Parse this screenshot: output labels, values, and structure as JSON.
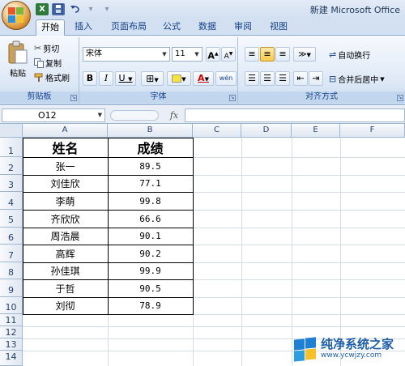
{
  "app": {
    "title": "新建 Microsoft Office",
    "colors": {
      "ribbon_blue": "#15428b",
      "accent_orange": "#d98b2b"
    }
  },
  "quick_access": [
    {
      "icon": "excel-icon"
    },
    {
      "icon": "save-icon"
    },
    {
      "icon": "undo-icon"
    },
    {
      "icon": "redo-icon"
    },
    {
      "icon": "customize-icon"
    }
  ],
  "tabs": [
    {
      "label": "开始",
      "active": true
    },
    {
      "label": "插入"
    },
    {
      "label": "页面布局"
    },
    {
      "label": "公式"
    },
    {
      "label": "数据"
    },
    {
      "label": "审阅"
    },
    {
      "label": "视图"
    }
  ],
  "ribbon": {
    "clipboard": {
      "label": "剪贴板",
      "paste": "粘贴",
      "cut": "剪切",
      "copy": "复制",
      "format_painter": "格式刷"
    },
    "font": {
      "label": "字体",
      "font_name": "宋体",
      "font_size": "11",
      "grow": "A",
      "shrink": "A",
      "bold": "B",
      "italic": "I",
      "underline": "U",
      "font_color_letter": "A",
      "phonetic": "wén"
    },
    "alignment": {
      "label": "对齐方式",
      "wrap_text": "自动换行",
      "merge_center": "合并后居中"
    }
  },
  "formula_bar": {
    "name_box": "O12",
    "fx": "fx",
    "formula": ""
  },
  "sheet": {
    "columns": [
      "A",
      "B",
      "C",
      "D",
      "E",
      "F"
    ],
    "rows": [
      "1",
      "2",
      "3",
      "4",
      "5",
      "6",
      "7",
      "8",
      "9",
      "10",
      "11",
      "12",
      "13",
      "14"
    ],
    "headers": {
      "name": "姓名",
      "score": "成绩"
    },
    "records": [
      {
        "name": "张一",
        "score": "89.5"
      },
      {
        "name": "刘佳欣",
        "score": "77.1"
      },
      {
        "name": "李萌",
        "score": "99.8"
      },
      {
        "name": "齐欣欣",
        "score": "66.6"
      },
      {
        "name": "周浩晨",
        "score": "90.1"
      },
      {
        "name": "高辉",
        "score": "90.2"
      },
      {
        "name": "孙佳琪",
        "score": "99.9"
      },
      {
        "name": "于哲",
        "score": "90.5"
      },
      {
        "name": "刘彻",
        "score": "78.9"
      }
    ]
  },
  "watermark": {
    "title": "纯净系统之家",
    "url": "www.ycwjzy.com"
  }
}
